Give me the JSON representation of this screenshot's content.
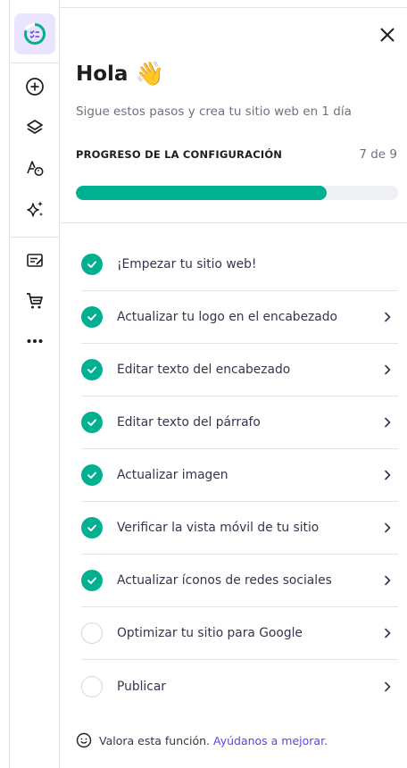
{
  "panel": {
    "greeting": "Hola",
    "wave_emoji": "👋",
    "subtitle": "Sigue estos pasos y crea tu sitio web en 1 día",
    "progress_label": "PROGRESO DE LA CONFIGURACIÓN",
    "progress_count": "7 de 9",
    "progress_fraction": 0.778
  },
  "steps": [
    {
      "label": "¡Empezar tu sitio web!",
      "done": true,
      "chevron": false
    },
    {
      "label": "Actualizar tu logo en el encabezado",
      "done": true,
      "chevron": true
    },
    {
      "label": "Editar texto del encabezado",
      "done": true,
      "chevron": true
    },
    {
      "label": "Editar texto del párrafo",
      "done": true,
      "chevron": true
    },
    {
      "label": "Actualizar imagen",
      "done": true,
      "chevron": true
    },
    {
      "label": "Verificar la vista móvil de tu sitio",
      "done": true,
      "chevron": true
    },
    {
      "label": "Actualizar íconos de redes sociales",
      "done": true,
      "chevron": true
    },
    {
      "label": "Optimizar tu sitio para Google",
      "done": false,
      "chevron": true
    },
    {
      "label": "Publicar",
      "done": false,
      "chevron": true
    }
  ],
  "feedback": {
    "text": "Valora esta función.",
    "link": "Ayúdanos a mejorar."
  },
  "colors": {
    "accent_green": "#00b090",
    "accent_purple": "#673de6"
  },
  "rail_icons": [
    "checklist-icon",
    "add-icon",
    "layers-icon",
    "styles-icon",
    "ai-sparkle-icon",
    "blog-icon",
    "cart-icon",
    "more-icon"
  ]
}
